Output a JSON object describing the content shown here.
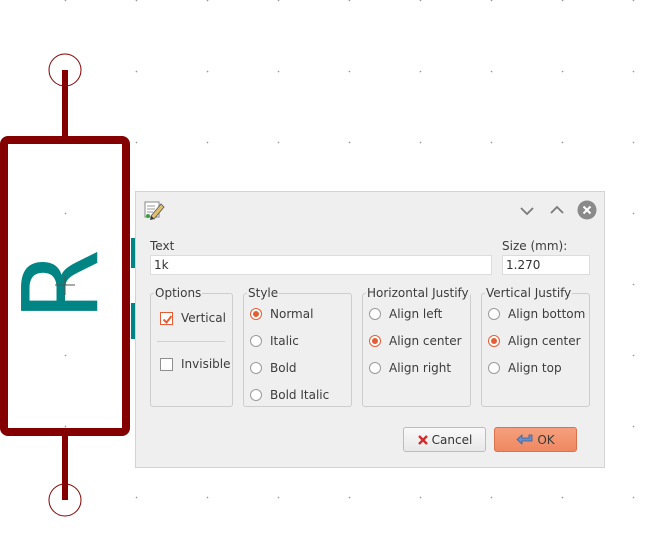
{
  "schematic": {
    "reference": "R"
  },
  "dialog": {
    "text_label": "Text",
    "text_value": "1k",
    "size_label": "Size (mm):",
    "size_value": "1.270",
    "options": {
      "title": "Options",
      "vertical": {
        "label": "Vertical",
        "checked": true
      },
      "invisible": {
        "label": "Invisible",
        "checked": false
      }
    },
    "style": {
      "title": "Style",
      "items": [
        "Normal",
        "Italic",
        "Bold",
        "Bold Italic"
      ],
      "selected": "Normal"
    },
    "horizontal_justify": {
      "title": "Horizontal Justify",
      "items": [
        "Align left",
        "Align center",
        "Align right"
      ],
      "selected": "Align center"
    },
    "vertical_justify": {
      "title": "Vertical Justify",
      "items": [
        "Align bottom",
        "Align center",
        "Align top"
      ],
      "selected": "Align center"
    },
    "cancel_label": "Cancel",
    "ok_label": "OK"
  },
  "colors": {
    "body": "#840000",
    "text": "#008484",
    "accent": "#e65d35"
  },
  "icons": [
    "edit-field-icon",
    "minimize-icon",
    "maximize-icon",
    "close-icon",
    "cancel-x-icon",
    "ok-arrow-icon"
  ]
}
